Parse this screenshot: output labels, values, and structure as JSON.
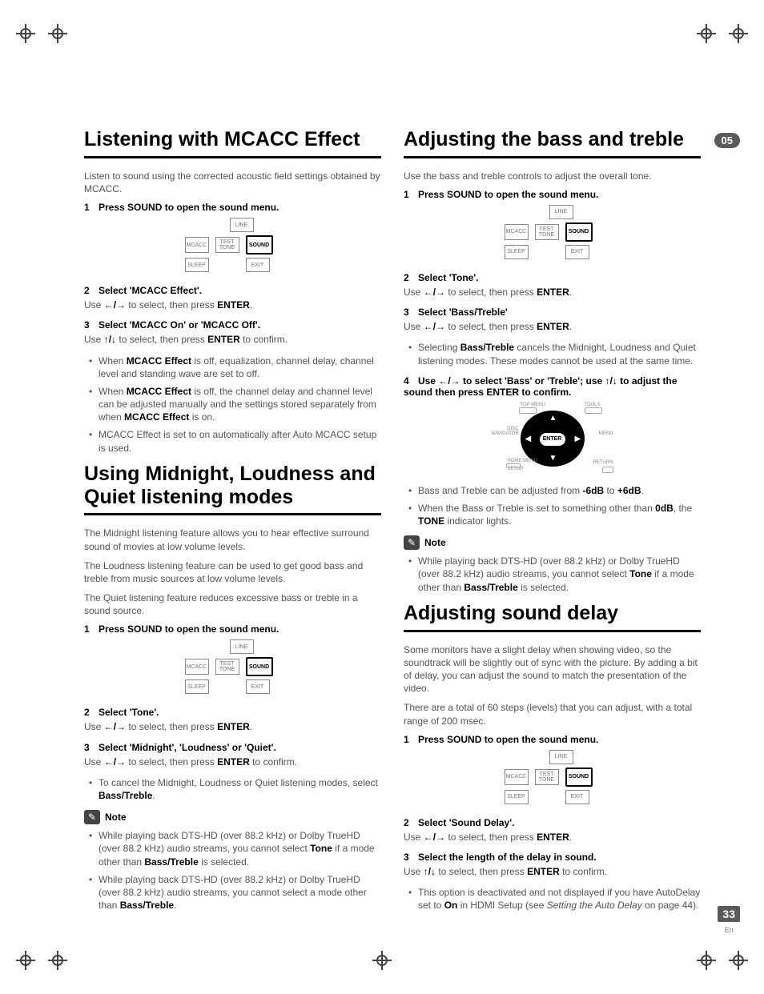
{
  "chapter_badge": "05",
  "page_number": "33",
  "page_lang": "En",
  "left": {
    "h1a": "Listening with MCACC Effect",
    "intro_a": "Listen to sound using the corrected acoustic field settings obtained by MCACC.",
    "steps_a": [
      {
        "num": "1",
        "title": "Press SOUND to open the sound menu."
      },
      {
        "num": "2",
        "title": "Select 'MCACC Effect'.",
        "note_pre": "Use ",
        "note_post": " to select, then press ",
        "note_bold": "ENTER",
        "note_end": "."
      },
      {
        "num": "3",
        "title": "Select 'MCACC On' or 'MCACC Off'.",
        "note_pre": "Use ",
        "note_post": " to select, then press ",
        "note_bold": "ENTER",
        "note_end": " to confirm."
      }
    ],
    "bullets_a": [
      {
        "pre": "When ",
        "b": "MCACC Effect",
        "post": " is off, equalization, channel delay, channel level and standing wave are set to off."
      },
      {
        "pre": "When ",
        "b": "MCACC Effect",
        "post_a": " is off, the channel delay and channel level can be adjusted manually and the settings stored separately from when ",
        "b2": "MCACC Effect",
        "post_b": " is on."
      },
      {
        "plain": "MCACC Effect is set to on automatically after Auto MCACC setup is used."
      }
    ],
    "h1b": "Using Midnight, Loudness and Quiet listening modes",
    "para_b1": "The Midnight listening feature allows you to hear effective surround sound of movies at low volume levels.",
    "para_b2": "The Loudness listening feature can be used to get good bass and treble from music sources at low volume levels.",
    "para_b3": "The Quiet listening feature reduces excessive bass or treble in a sound source.",
    "steps_b": [
      {
        "num": "1",
        "title": "Press SOUND to open the sound menu."
      },
      {
        "num": "2",
        "title": "Select 'Tone'.",
        "note_pre": "Use ",
        "note_post": " to select, then press ",
        "note_bold": "ENTER",
        "note_end": "."
      },
      {
        "num": "3",
        "title": "Select 'Midnight', 'Loudness' or 'Quiet'.",
        "note_pre": "Use ",
        "note_post": " to select, then press ",
        "note_bold": "ENTER",
        "note_end": " to confirm."
      }
    ],
    "bullet_b1_pre": "To cancel the Midnight, Loudness or Quiet listening modes, select ",
    "bullet_b1_b": "Bass/Treble",
    "bullet_b1_post": ".",
    "note_label": "Note",
    "note_bullets": [
      {
        "pre": "While playing back DTS-HD (over 88.2 kHz) or Dolby TrueHD (over 88.2 kHz) audio streams, you cannot select ",
        "b": "Tone",
        "post_a": " if a mode other than ",
        "b2": "Bass/Treble",
        "post_b": " is selected."
      },
      {
        "pre": "While playing back DTS-HD (over 88.2 kHz) or Dolby TrueHD (over 88.2 kHz) audio streams, you cannot select a mode other than ",
        "b": "Bass/Treble",
        "post": "."
      }
    ]
  },
  "right": {
    "h1a": "Adjusting the bass and treble",
    "intro_a": "Use the bass and treble controls to adjust the overall tone.",
    "steps_a": [
      {
        "num": "1",
        "title": "Press SOUND to open the sound menu."
      },
      {
        "num": "2",
        "title": "Select 'Tone'.",
        "note_pre": "Use ",
        "note_post": " to select, then press ",
        "note_bold": "ENTER",
        "note_end": "."
      },
      {
        "num": "3",
        "title": "Select 'Bass/Treble'",
        "note_pre": "Use ",
        "note_post": " to select, then press ",
        "note_bold": "ENTER",
        "note_end": "."
      }
    ],
    "bullet_a1_pre": "Selecting ",
    "bullet_a1_b": "Bass/Treble",
    "bullet_a1_post": " cancels the Midnight, Loudness and Quiet listening modes. These modes cannot be used at the same time.",
    "step4_num": "4",
    "step4_text": "Use ←/→ to select 'Bass' or 'Treble'; use ↑/↓ to adjust the sound then press ENTER to confirm.",
    "navpad": {
      "enter": "ENTER",
      "labels": {
        "tl": "TOP MENU",
        "tr": "TOOLS",
        "ml": "DISC NAVIGATOR",
        "mr": "MENU",
        "bl1": "HOME MENU",
        "bl2": "SETUP",
        "br": "RETURN"
      }
    },
    "bullets_a2": [
      {
        "pre": "Bass and Treble can be adjusted from ",
        "b": "-6dB",
        "mid": " to ",
        "b2": "+6dB",
        "post": "."
      },
      {
        "pre": "When the Bass or Treble is set to something other than ",
        "b": "0dB",
        "post_a": ", the ",
        "b2": "TONE",
        "post_b": " indicator lights."
      }
    ],
    "note_label": "Note",
    "note_bullet_pre": "While playing back DTS-HD (over 88.2 kHz) or Dolby TrueHD (over 88.2 kHz) audio streams, you cannot select ",
    "note_bullet_b": "Tone",
    "note_bullet_mid": " if a mode other than ",
    "note_bullet_b2": "Bass/Treble",
    "note_bullet_post": " is selected.",
    "h1b": "Adjusting sound delay",
    "para_b1": "Some monitors have a slight delay when showing video, so the soundtrack will be slightly out of sync with the picture. By adding a bit of delay, you can adjust the sound to match the presentation of the video.",
    "para_b2": "There are a total of 60 steps (levels) that you can adjust, with a total range of 200 msec.",
    "steps_b": [
      {
        "num": "1",
        "title": "Press SOUND to open the sound menu."
      },
      {
        "num": "2",
        "title": "Select 'Sound Delay'.",
        "note_pre": "Use ",
        "note_post": " to select, then press ",
        "note_bold": "ENTER",
        "note_end": "."
      },
      {
        "num": "3",
        "title": "Select the length of the delay in sound.",
        "note_pre": "Use ",
        "note_post": " to select, then press ",
        "note_bold": "ENTER",
        "note_end": " to confirm."
      }
    ],
    "bullet_b_pre": "This option is deactivated and not displayed if you have AutoDelay set to ",
    "bullet_b_b": "On",
    "bullet_b_mid": " in HDMI Setup (see ",
    "bullet_b_italic": "Setting the Auto Delay",
    "bullet_b_post": " on page 44)."
  },
  "btngrid": {
    "line": "LINE",
    "mcacc": "MCACC",
    "testtone": "TEST TONE",
    "sound": "SOUND",
    "sleep": "SLEEP",
    "exit": "EXIT"
  },
  "arrows": {
    "lr": "←/→",
    "ud": "↑/↓"
  }
}
